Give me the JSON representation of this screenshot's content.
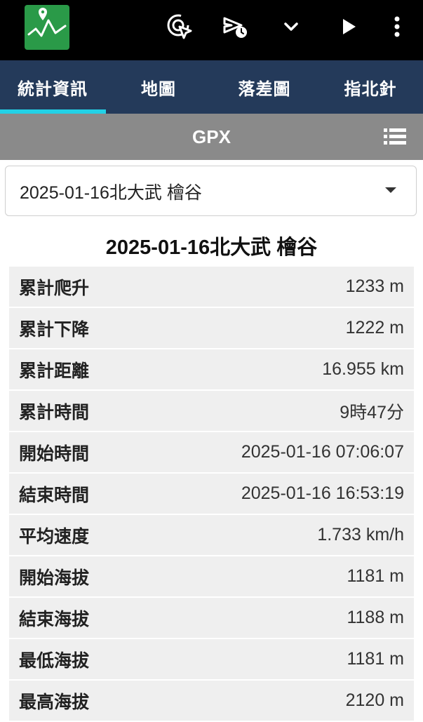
{
  "appbar": {
    "icons": [
      "app-logo-icon",
      "gps-cursor-icon",
      "timer-send-icon",
      "chevron-down-icon",
      "play-icon",
      "more-vert-icon"
    ]
  },
  "tabs": [
    {
      "label": "統計資訊",
      "active": true
    },
    {
      "label": "地圖",
      "active": false
    },
    {
      "label": "落差圖",
      "active": false
    },
    {
      "label": "指北針",
      "active": false
    }
  ],
  "section": {
    "title": "GPX",
    "icon": "list-icon"
  },
  "dropdown": {
    "selected": "2025-01-16北大武 檜谷"
  },
  "track_title": "2025-01-16北大武 檜谷",
  "stats": [
    {
      "label": "累計爬升",
      "value": "1233 m"
    },
    {
      "label": "累計下降",
      "value": "1222 m"
    },
    {
      "label": "累計距離",
      "value": "16.955 km"
    },
    {
      "label": "累計時間",
      "value": "9時47分"
    },
    {
      "label": "開始時間",
      "value": "2025-01-16 07:06:07"
    },
    {
      "label": "結束時間",
      "value": "2025-01-16 16:53:19"
    },
    {
      "label": "平均速度",
      "value": "1.733 km/h"
    },
    {
      "label": "開始海拔",
      "value": "1181 m"
    },
    {
      "label": "結束海拔",
      "value": "1188 m"
    },
    {
      "label": "最低海拔",
      "value": "1181 m"
    },
    {
      "label": "最高海拔",
      "value": "2120 m"
    }
  ],
  "colors": {
    "appbar": "#000000",
    "tabbar": "#243a5a",
    "tab_indicator": "#22d1e6",
    "section_header": "#8a8a8a",
    "logo_bg": "#2a9a48",
    "row_bg": "#efefef"
  }
}
